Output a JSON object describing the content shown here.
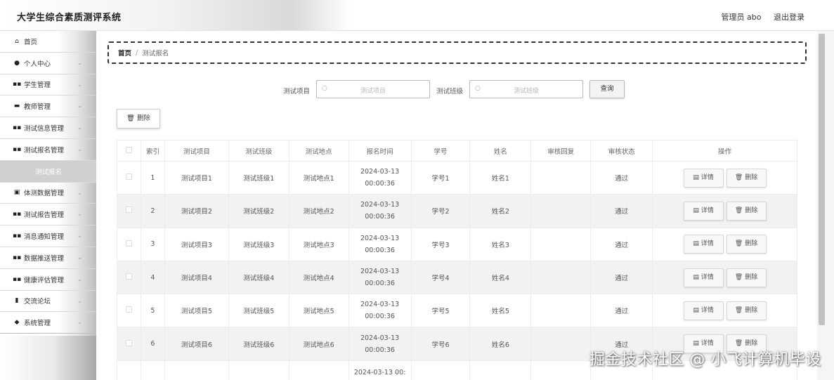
{
  "header": {
    "title": "大学生综合素质测评系统",
    "user": "管理员 abo",
    "logout": "退出登录"
  },
  "sidebar": {
    "items": [
      {
        "label": "首页",
        "icon": "home-icon",
        "glyph": "⌂",
        "chevron": false
      },
      {
        "label": "个人中心",
        "icon": "user-icon",
        "glyph": "●",
        "chevron": true
      },
      {
        "label": "学生管理",
        "icon": "grid-icon",
        "glyph": "▪▪",
        "chevron": true
      },
      {
        "label": "教师管理",
        "icon": "briefcase-icon",
        "glyph": "▬",
        "chevron": true
      },
      {
        "label": "测试信息管理",
        "icon": "grid-icon",
        "glyph": "▪▪",
        "chevron": true
      },
      {
        "label": "测试报名管理",
        "icon": "grid-icon",
        "glyph": "▪▪",
        "chevron": true
      },
      {
        "label": "测试报名",
        "sub": true
      },
      {
        "label": "体测数据管理",
        "icon": "clipboard-icon",
        "glyph": "▣",
        "chevron": true
      },
      {
        "label": "测试报告管理",
        "icon": "grid-icon",
        "glyph": "▪▪",
        "chevron": true
      },
      {
        "label": "消息通知管理",
        "icon": "grid-icon",
        "glyph": "▪▪",
        "chevron": true
      },
      {
        "label": "数据推送管理",
        "icon": "grid-icon",
        "glyph": "▪▪",
        "chevron": true
      },
      {
        "label": "健康评估管理",
        "icon": "grid-icon",
        "glyph": "▪▪",
        "chevron": true
      },
      {
        "label": "交流论坛",
        "icon": "chart-icon",
        "glyph": "▮",
        "chevron": true
      },
      {
        "label": "系统管理",
        "icon": "thumb-icon",
        "glyph": "◆",
        "chevron": true
      }
    ]
  },
  "breadcrumb": {
    "home": "首页",
    "separator": "/",
    "current": "测试报名"
  },
  "search": {
    "item_label": "测试项目",
    "item_placeholder": "测试项目",
    "class_label": "测试班级",
    "class_placeholder": "测试班级",
    "query_button": "查询"
  },
  "toolbar": {
    "delete_label": "删除",
    "delete_icon": "trash-icon"
  },
  "table": {
    "columns": [
      "索引",
      "测试项目",
      "测试班级",
      "测试地点",
      "报名时间",
      "学号",
      "姓名",
      "审核回复",
      "审核状态",
      "操作"
    ],
    "detail_label": "详情",
    "delete_label": "删除",
    "rows": [
      {
        "idx": "1",
        "item": "测试项目1",
        "class": "测试班级1",
        "loc": "测试地点1",
        "time": "2024-03-13 00:00:36",
        "sid": "学号1",
        "name": "姓名1",
        "reply": "",
        "status": "通过"
      },
      {
        "idx": "2",
        "item": "测试项目2",
        "class": "测试班级2",
        "loc": "测试地点2",
        "time": "2024-03-13 00:00:36",
        "sid": "学号2",
        "name": "姓名2",
        "reply": "",
        "status": "通过"
      },
      {
        "idx": "3",
        "item": "测试项目3",
        "class": "测试班级3",
        "loc": "测试地点3",
        "time": "2024-03-13 00:00:36",
        "sid": "学号3",
        "name": "姓名3",
        "reply": "",
        "status": "通过"
      },
      {
        "idx": "4",
        "item": "测试项目4",
        "class": "测试班级4",
        "loc": "测试地点4",
        "time": "2024-03-13 00:00:36",
        "sid": "学号4",
        "name": "姓名4",
        "reply": "",
        "status": "通过"
      },
      {
        "idx": "5",
        "item": "测试项目5",
        "class": "测试班级5",
        "loc": "测试地点5",
        "time": "2024-03-13 00:00:36",
        "sid": "学号5",
        "name": "姓名5",
        "reply": "",
        "status": "通过"
      },
      {
        "idx": "6",
        "item": "测试项目6",
        "class": "测试班级6",
        "loc": "测试地点6",
        "time": "2024-03-13 00:00:36",
        "sid": "学号6",
        "name": "姓名6",
        "reply": "",
        "status": "通过"
      }
    ],
    "partial_row_time": "2024-03-13 00:"
  },
  "watermark": "掘金技术社区 @ 小飞计算机毕设"
}
